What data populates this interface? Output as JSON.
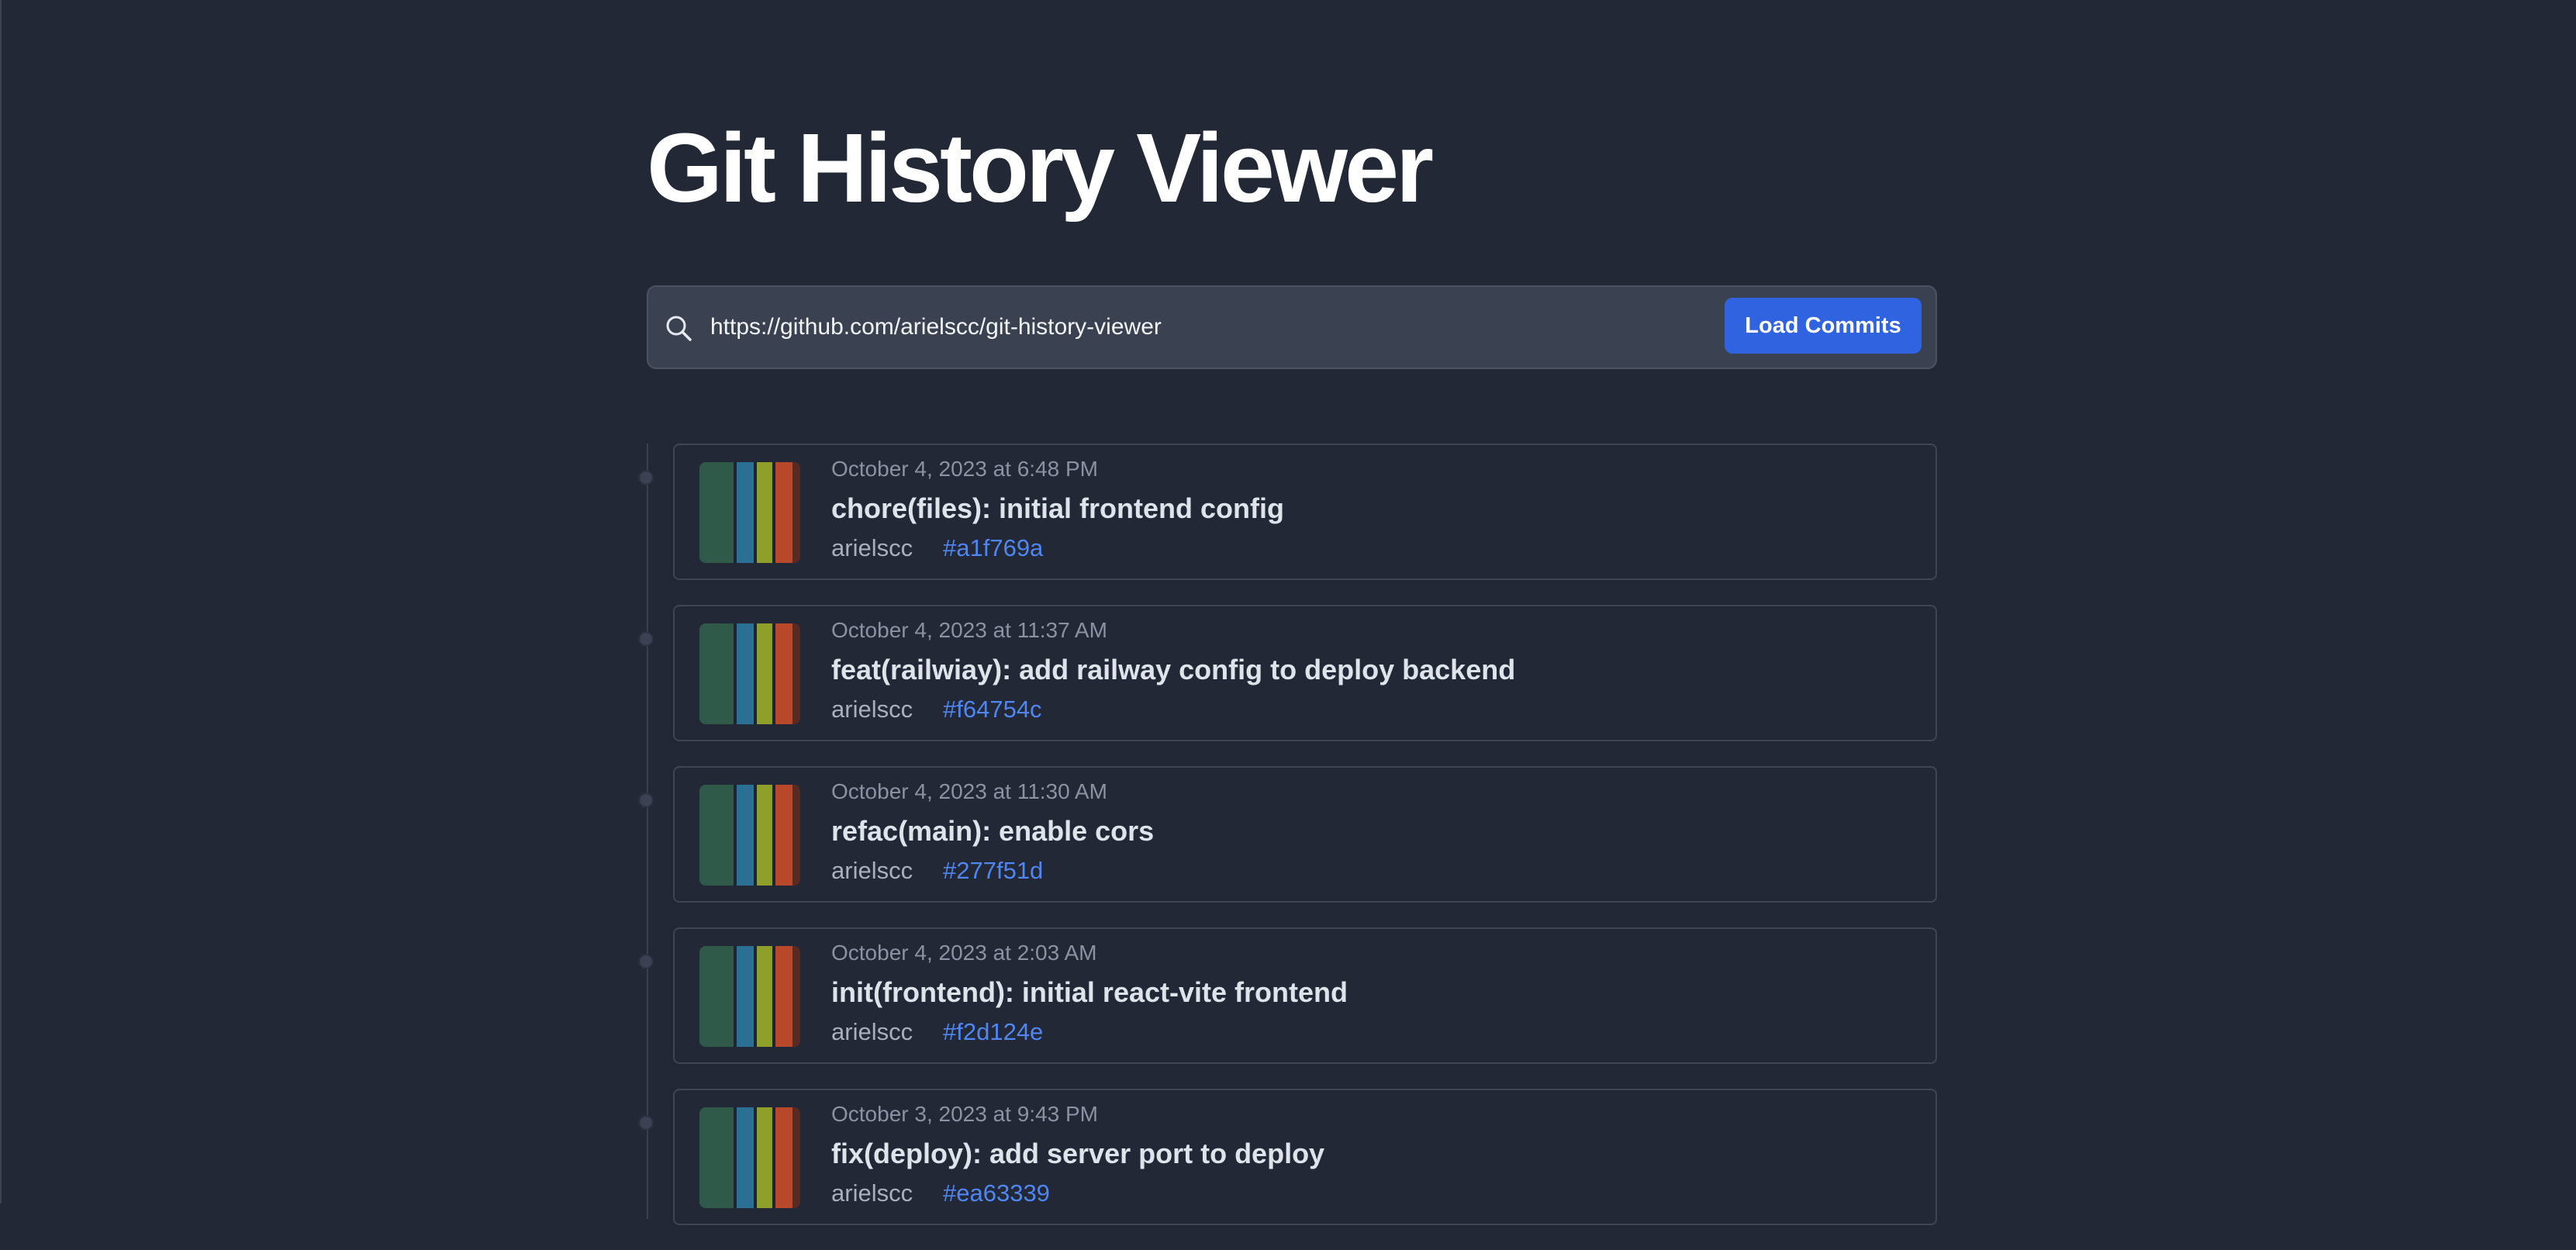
{
  "header": {
    "title": "Git History Viewer"
  },
  "search": {
    "value": "https://github.com/arielscc/git-history-viewer",
    "icon": "search-icon",
    "button_label": "Load Commits"
  },
  "colors": {
    "background": "#222836",
    "accent": "#2f63e0",
    "hash_link": "#4f86f2"
  },
  "commits": [
    {
      "date": "October 4, 2023 at 6:48 PM",
      "message": "chore(files): initial frontend config",
      "author": "arielscc",
      "hash": "#a1f769a"
    },
    {
      "date": "October 4, 2023 at 11:37 AM",
      "message": "feat(railwiay): add railway config to deploy backend",
      "author": "arielscc",
      "hash": "#f64754c"
    },
    {
      "date": "October 4, 2023 at 11:30 AM",
      "message": "refac(main): enable cors",
      "author": "arielscc",
      "hash": "#277f51d"
    },
    {
      "date": "October 4, 2023 at 2:03 AM",
      "message": "init(frontend): initial react-vite frontend",
      "author": "arielscc",
      "hash": "#f2d124e"
    },
    {
      "date": "October 3, 2023 at 9:43 PM",
      "message": "fix(deploy): add server port to deploy",
      "author": "arielscc",
      "hash": "#ea63339"
    }
  ]
}
